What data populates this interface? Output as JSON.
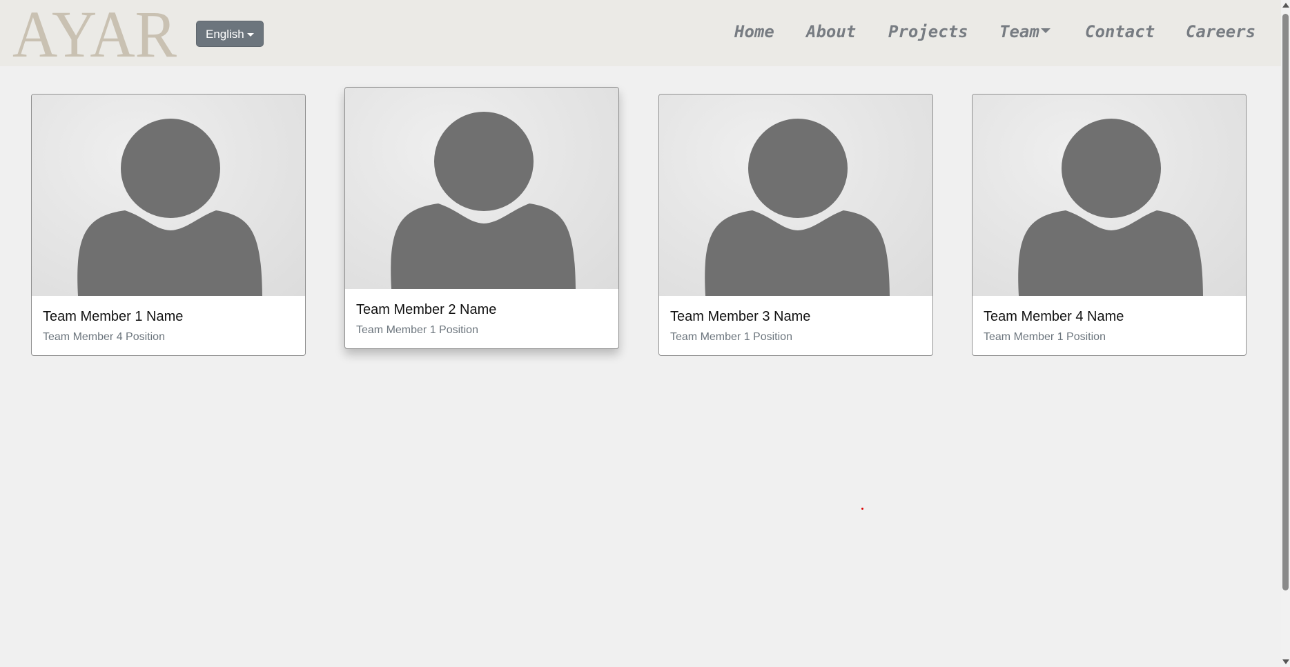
{
  "brand": {
    "logo_text": "AYAR",
    "logo_color": "#c9c1b2"
  },
  "language": {
    "selected": "English"
  },
  "nav": {
    "home": "Home",
    "about": "About",
    "projects": "Projects",
    "team": "Team",
    "contact": "Contact",
    "careers": "Careers"
  },
  "team": {
    "members": [
      {
        "name": "Team Member 1 Name",
        "position": "Team Member 4 Position"
      },
      {
        "name": "Team Member 2 Name",
        "position": "Team Member 1 Position"
      },
      {
        "name": "Team Member 3 Name",
        "position": "Team Member 1 Position"
      },
      {
        "name": "Team Member 4 Name",
        "position": "Team Member 1 Position"
      }
    ]
  },
  "colors": {
    "navbar_bg": "#ebeae6",
    "nav_text": "#777c82",
    "button_bg": "#6c757d",
    "page_bg": "#f0f0f0",
    "avatar_fill": "#707070"
  }
}
